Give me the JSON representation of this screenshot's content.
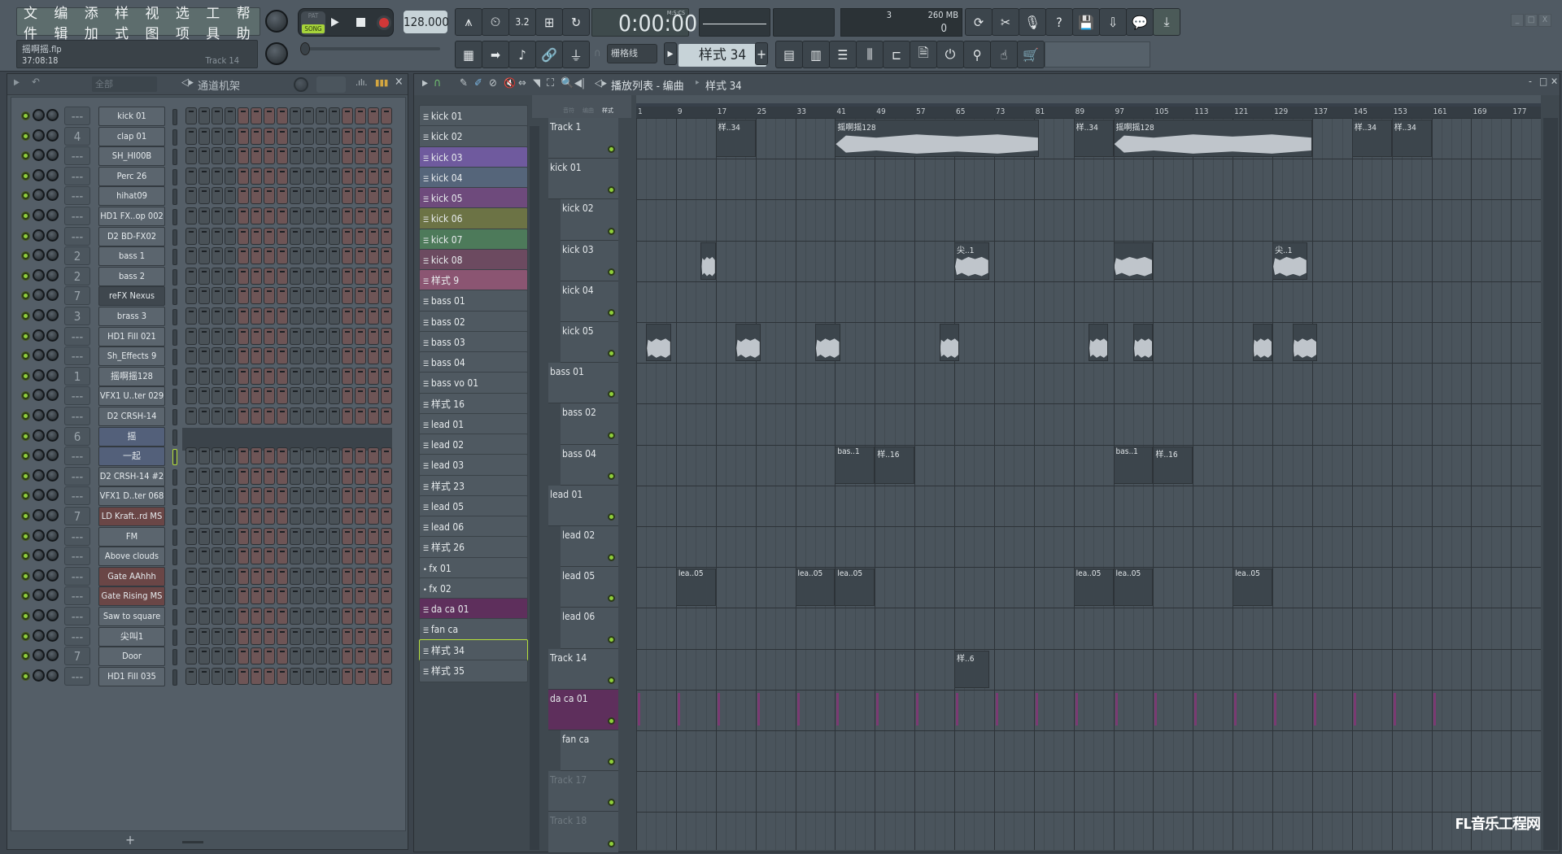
{
  "menu": [
    "文件",
    "编辑",
    "添加",
    "样式",
    "视图",
    "选项",
    "工具",
    "帮助"
  ],
  "project": {
    "filename": "摇啊摇.flp",
    "time": "37:08:18",
    "track": "Track 14"
  },
  "transport": {
    "pat_label": "PAT",
    "song_label": "SONG",
    "tempo": "128.000",
    "clock": "0:00:00",
    "clock_unit": "M:S:CS"
  },
  "cpu": {
    "polyphony": "3",
    "memory": "260 MB",
    "value": "0"
  },
  "snap": "栅格线",
  "current_pattern": "样式 34",
  "rack": {
    "filter": "全部",
    "title": "通道机架",
    "channels": [
      {
        "mix": "---",
        "name": "kick 01"
      },
      {
        "mix": "4",
        "name": "clap 01"
      },
      {
        "mix": "---",
        "name": "SH_HI00B"
      },
      {
        "mix": "---",
        "name": "Perc 26"
      },
      {
        "mix": "---",
        "name": "hihat09"
      },
      {
        "mix": "---",
        "name": "HD1 FX..op 002"
      },
      {
        "mix": "---",
        "name": "D2 BD-FX02"
      },
      {
        "mix": "2",
        "name": "bass 1"
      },
      {
        "mix": "2",
        "name": "bass 2"
      },
      {
        "mix": "7",
        "name": "reFX Nexus"
      },
      {
        "mix": "3",
        "name": "brass 3"
      },
      {
        "mix": "---",
        "name": "HD1 Fill 021"
      },
      {
        "mix": "---",
        "name": "Sh_Effects 9"
      },
      {
        "mix": "1",
        "name": "摇啊摇128"
      },
      {
        "mix": "---",
        "name": "VFX1 U..ter 029"
      },
      {
        "mix": "---",
        "name": "D2 CRSH-14"
      },
      {
        "mix": "6",
        "name": "摇"
      },
      {
        "mix": "---",
        "name": "一起"
      },
      {
        "mix": "---",
        "name": "D2 CRSH-14 #2"
      },
      {
        "mix": "---",
        "name": "VFX1 D..ter 068"
      },
      {
        "mix": "7",
        "name": "LD Kraft..rd   MS"
      },
      {
        "mix": "---",
        "name": "FM"
      },
      {
        "mix": "---",
        "name": "Above clouds"
      },
      {
        "mix": "---",
        "name": "Gate AAhhh"
      },
      {
        "mix": "---",
        "name": "Gate Rising MS"
      },
      {
        "mix": "---",
        "name": "Saw to square"
      },
      {
        "mix": "---",
        "name": "尖叫1"
      },
      {
        "mix": "7",
        "name": "Door"
      },
      {
        "mix": "---",
        "name": "HD1 Fill 035"
      }
    ],
    "add_label": "+"
  },
  "playlist": {
    "title": "播放列表 - 编曲",
    "crumb": "样式 34",
    "picker_tabs": [
      "音符",
      "编曲",
      "样式"
    ],
    "patterns": [
      {
        "name": "kick 01",
        "color": "#4f5961"
      },
      {
        "name": "kick 02",
        "color": "#4f5961"
      },
      {
        "name": "kick 03",
        "color": "#6f5a9e"
      },
      {
        "name": "kick 04",
        "color": "#55657a"
      },
      {
        "name": "kick 05",
        "color": "#6e4a7c"
      },
      {
        "name": "kick 06",
        "color": "#6c7345"
      },
      {
        "name": "kick 07",
        "color": "#4d7a5a"
      },
      {
        "name": "kick 08",
        "color": "#6c4a60"
      },
      {
        "name": "样式 9",
        "color": "#8b5572"
      },
      {
        "name": "bass 01",
        "color": "#4f5961"
      },
      {
        "name": "bass 02",
        "color": "#4f5961"
      },
      {
        "name": "bass 03",
        "color": "#4f5961"
      },
      {
        "name": "bass 04",
        "color": "#4f5961"
      },
      {
        "name": "bass vo 01",
        "color": "#4f5961"
      },
      {
        "name": "样式 16",
        "color": "#4f5961"
      },
      {
        "name": "lead 01",
        "color": "#4f5961"
      },
      {
        "name": "lead 02",
        "color": "#4f5961"
      },
      {
        "name": "lead 03",
        "color": "#4f5961"
      },
      {
        "name": "样式 23",
        "color": "#4f5961"
      },
      {
        "name": "lead 05",
        "color": "#4f5961"
      },
      {
        "name": "lead 06",
        "color": "#4f5961"
      },
      {
        "name": "样式 26",
        "color": "#4f5961"
      },
      {
        "name": "fx 01",
        "color": "#4f5961"
      },
      {
        "name": "fx 02",
        "color": "#4f5961"
      },
      {
        "name": "da ca 01",
        "color": "#5e2f5c"
      },
      {
        "name": "fan ca",
        "color": "#4f5961"
      },
      {
        "name": "样式 34",
        "color": "#4f5961"
      },
      {
        "name": "样式 35",
        "color": "#4f5961"
      }
    ],
    "tracks": [
      "Track 1",
      "kick 01",
      "kick 02",
      "kick 03",
      "kick 04",
      "kick 05",
      "bass 01",
      "bass 02",
      "bass 04",
      "lead 01",
      "lead 02",
      "lead 05",
      "lead 06",
      "Track 14",
      "da ca 01",
      "fan ca",
      "Track 17",
      "Track 18"
    ],
    "ruler": [
      "1",
      "9",
      "17",
      "25",
      "33",
      "41",
      "49",
      "57",
      "65",
      "73",
      "81",
      "89",
      "97",
      "105",
      "113",
      "121",
      "129",
      "137",
      "145",
      "153",
      "161",
      "169",
      "177"
    ],
    "clips": [
      {
        "track": 0,
        "bar": 17,
        "len": 8,
        "label": "样..34",
        "type": "pattern"
      },
      {
        "track": 0,
        "bar": 41,
        "len": 41,
        "label": "摇啊摇128",
        "type": "audio"
      },
      {
        "track": 0,
        "bar": 89,
        "len": 8,
        "label": "样..34",
        "type": "pattern"
      },
      {
        "track": 0,
        "bar": 97,
        "len": 40,
        "label": "摇啊摇128",
        "type": "audio"
      },
      {
        "track": 0,
        "bar": 145,
        "len": 8,
        "label": "样..34",
        "type": "pattern"
      },
      {
        "track": 0,
        "bar": 153,
        "len": 8,
        "label": "样..34",
        "type": "pattern"
      },
      {
        "track": 3,
        "bar": 14,
        "len": 3,
        "label": "",
        "type": "audio"
      },
      {
        "track": 3,
        "bar": 65,
        "len": 7,
        "label": "尖..1",
        "type": "audio"
      },
      {
        "track": 3,
        "bar": 97,
        "len": 8,
        "label": "",
        "type": "audio"
      },
      {
        "track": 3,
        "bar": 129,
        "len": 7,
        "label": "尖..1",
        "type": "audio"
      },
      {
        "track": 5,
        "bar": 3,
        "len": 5,
        "label": "",
        "type": "audio"
      },
      {
        "track": 5,
        "bar": 21,
        "len": 5,
        "label": "",
        "type": "audio"
      },
      {
        "track": 5,
        "bar": 37,
        "len": 5,
        "label": "",
        "type": "audio"
      },
      {
        "track": 5,
        "bar": 62,
        "len": 4,
        "label": "",
        "type": "audio"
      },
      {
        "track": 5,
        "bar": 92,
        "len": 4,
        "label": "",
        "type": "audio"
      },
      {
        "track": 5,
        "bar": 101,
        "len": 4,
        "label": "",
        "type": "audio"
      },
      {
        "track": 5,
        "bar": 125,
        "len": 4,
        "label": "",
        "type": "audio"
      },
      {
        "track": 5,
        "bar": 133,
        "len": 5,
        "label": "",
        "type": "audio"
      },
      {
        "track": 8,
        "bar": 41,
        "len": 8,
        "label": "bas..1",
        "type": "pattern"
      },
      {
        "track": 8,
        "bar": 49,
        "len": 8,
        "label": "样..16",
        "type": "pattern"
      },
      {
        "track": 8,
        "bar": 97,
        "len": 8,
        "label": "bas..1",
        "type": "pattern"
      },
      {
        "track": 8,
        "bar": 105,
        "len": 8,
        "label": "样..16",
        "type": "pattern"
      },
      {
        "track": 11,
        "bar": 9,
        "len": 8,
        "label": "lea..05",
        "type": "pattern"
      },
      {
        "track": 11,
        "bar": 33,
        "len": 8,
        "label": "lea..05",
        "type": "pattern"
      },
      {
        "track": 11,
        "bar": 41,
        "len": 8,
        "label": "lea..05",
        "type": "pattern"
      },
      {
        "track": 11,
        "bar": 89,
        "len": 8,
        "label": "lea..05",
        "type": "pattern"
      },
      {
        "track": 11,
        "bar": 97,
        "len": 8,
        "label": "lea..05",
        "type": "pattern"
      },
      {
        "track": 11,
        "bar": 121,
        "len": 8,
        "label": "lea..05",
        "type": "pattern"
      },
      {
        "track": 13,
        "bar": 65,
        "len": 7,
        "label": "样..6",
        "type": "pattern"
      }
    ]
  },
  "watermark": "FL音乐工程网"
}
